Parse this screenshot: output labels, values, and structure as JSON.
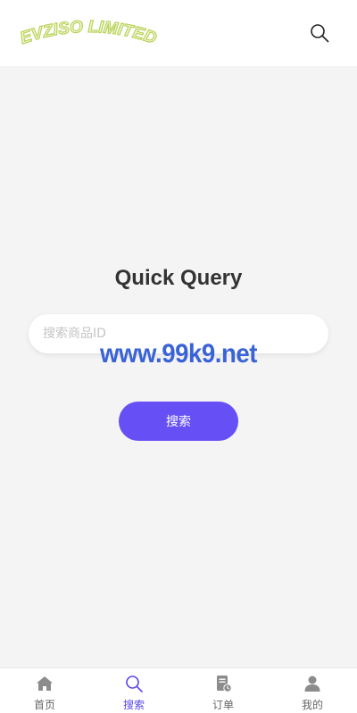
{
  "header": {
    "logo_text": "EVZISO LIMITED",
    "search_icon": "search-icon"
  },
  "main": {
    "title": "Quick Query",
    "search_placeholder": "搜索商品ID",
    "watermark": "www.99k9.net",
    "submit_label": "搜索"
  },
  "tabbar": {
    "items": [
      {
        "label": "首页",
        "icon": "home-icon",
        "active": false
      },
      {
        "label": "搜索",
        "icon": "search-icon",
        "active": true
      },
      {
        "label": "订单",
        "icon": "order-icon",
        "active": false
      },
      {
        "label": "我的",
        "icon": "user-icon",
        "active": false
      }
    ]
  },
  "colors": {
    "accent": "#6650f5",
    "active_tab": "#5a48e6",
    "watermark": "#3a63d6",
    "logo": "#cfe38a"
  }
}
